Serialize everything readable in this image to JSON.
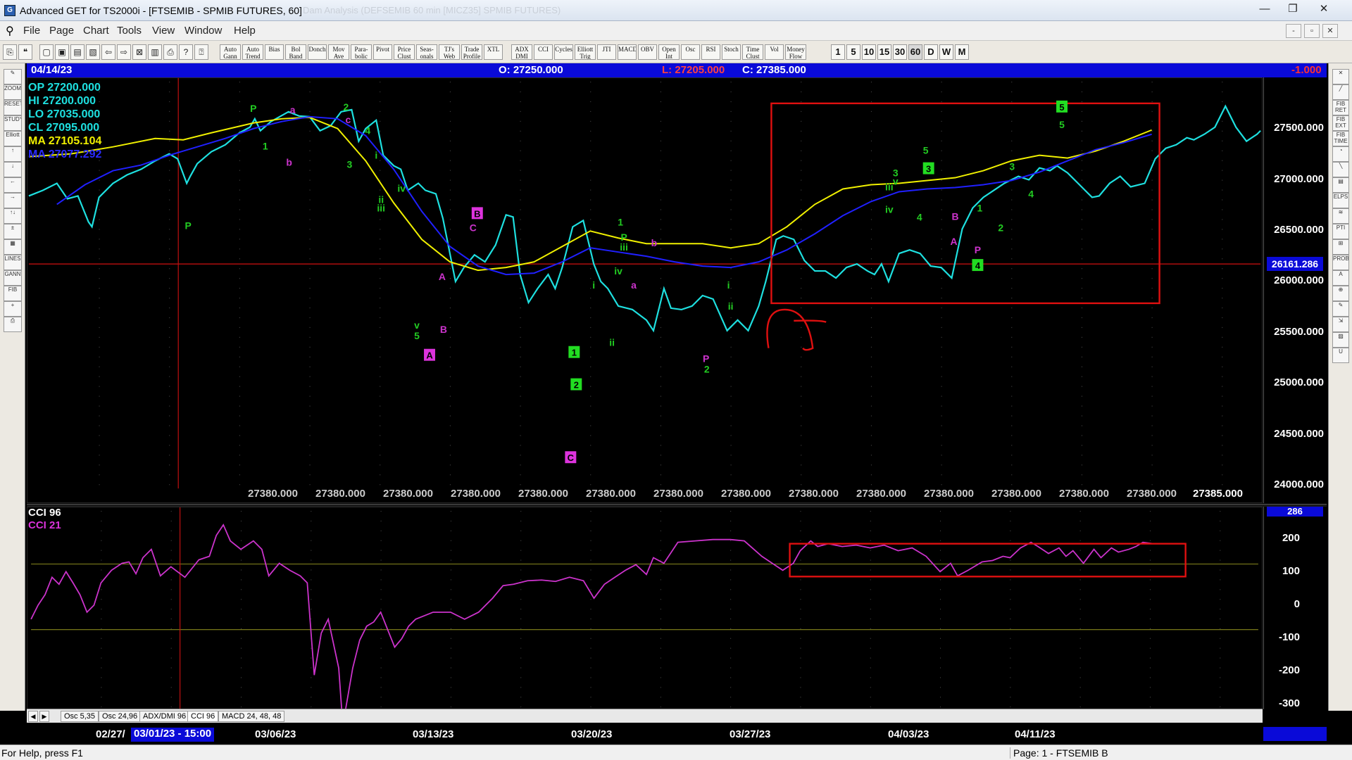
{
  "window": {
    "title": "Advanced GET for TS2000i - [FTSEMIB - SPMIB FUTURES, 60]",
    "ghost_title": "Dam Analysis (DEFSEMIB 60 min [MICZ35] SPMIB FUTURES)",
    "min_label": "—",
    "max_label": "❐",
    "close_label": "✕"
  },
  "menu": {
    "items": [
      "File",
      "Page",
      "Chart",
      "Tools",
      "View",
      "Window",
      "Help"
    ],
    "mdi_min": "-",
    "mdi_restore": "▫",
    "mdi_close": "✕"
  },
  "toolbar": {
    "icons_left": [
      "⎘",
      "❝",
      "▢",
      "▣",
      "▤",
      "▧",
      "⇦",
      "⇨",
      "⊠",
      "▥",
      "⎙",
      "?",
      "⍰"
    ],
    "tools": [
      "Auto Gann",
      "Auto Trend",
      "Bias",
      "Bol Band",
      "Donch",
      "Mov Ave",
      "Para- bolic",
      "Pivot",
      "Price Clust",
      "Seas- onals",
      "TJ's Web",
      "Trade Profile",
      "XTL",
      "ADX DMI",
      "CCI",
      "Cycles",
      "Elliott Trig",
      "JTI",
      "MACD",
      "OBV",
      "Open Int",
      "Osc",
      "RSI",
      "Stoch",
      "Time Clust",
      "Vol",
      "Money Flow"
    ],
    "timeframes": [
      "1",
      "5",
      "10",
      "15",
      "30",
      "60",
      "D",
      "W",
      "M"
    ],
    "active_timeframe": "60"
  },
  "left_tools": [
    "✎",
    "ZOOM",
    "RESET",
    "STUDY",
    "Elliott",
    "↑",
    "↓",
    "←",
    "→",
    "↑↓",
    "±",
    "▦",
    "LINES",
    "GANN",
    "FIB",
    "+",
    "⎙"
  ],
  "right_tools": [
    "✕",
    "╱",
    "FIB RET",
    "FIB EXT",
    "FIB TIME",
    "◔",
    "╲",
    "▤",
    "ELPS",
    "≋",
    "PTI",
    "⊞",
    "PROB",
    "A",
    "⊕",
    "✎",
    "⇲",
    "▨",
    "U"
  ],
  "header": {
    "date": "04/14/23",
    "open": "O: 27250.000",
    "low": "L: 27205.000",
    "close": "C: 27385.000",
    "change": "-1.000"
  },
  "ohlc_box": {
    "op": "OP 27200.000",
    "hi": "HI  27200.000",
    "lo": "LO  27035.000",
    "cl": "CL  27095.000",
    "ma1": "MA  27105.104",
    "ma2": "MA  27077.292"
  },
  "price_axis": {
    "ticks": [
      "27500.000",
      "27000.000",
      "26500.000",
      "26000.000",
      "25500.000",
      "25000.000",
      "24500.000",
      "24000.000"
    ],
    "current_marker": "26161.286"
  },
  "price_bottom": {
    "labels": [
      "27380.000",
      "27380.000",
      "27380.000",
      "27380.000",
      "27380.000",
      "27380.000",
      "27380.000",
      "27380.000",
      "27380.000",
      "27380.000",
      "27380.000",
      "27380.000",
      "27380.000",
      "27380.000"
    ],
    "last": "27385.000"
  },
  "elliott_labels": [
    {
      "t": "P",
      "c": "#22cc22"
    },
    {
      "t": "a",
      "c": "#cc33cc"
    },
    {
      "t": "1",
      "c": "#22cc22"
    },
    {
      "t": "b",
      "c": "#cc33cc"
    },
    {
      "t": "P",
      "c": "#22cc22"
    },
    {
      "t": "2",
      "c": "#22cc22"
    },
    {
      "t": "c",
      "c": "#cc33cc"
    },
    {
      "t": "3",
      "c": "#22cc22"
    },
    {
      "t": "4",
      "c": "#22cc22"
    },
    {
      "t": "i",
      "c": "#22cc22"
    },
    {
      "t": "iv",
      "c": "#22cc22"
    },
    {
      "t": "ii",
      "c": "#22cc22"
    },
    {
      "t": "iii",
      "c": "#22cc22"
    },
    {
      "t": "A",
      "c": "#cc33cc"
    },
    {
      "t": "v",
      "c": "#22cc22"
    },
    {
      "t": "5",
      "c": "#22cc22"
    },
    {
      "t": "B",
      "c": "#cc33cc"
    },
    {
      "t": "C",
      "c": "#cc33cc"
    },
    {
      "t": "1",
      "c": "#22cc22"
    },
    {
      "t": "iii",
      "c": "#22cc22"
    },
    {
      "t": "P",
      "c": "#22cc22"
    },
    {
      "t": "b",
      "c": "#cc33cc"
    },
    {
      "t": "iv",
      "c": "#22cc22"
    },
    {
      "t": "a",
      "c": "#cc33cc"
    },
    {
      "t": "i",
      "c": "#22cc22"
    },
    {
      "t": "ii",
      "c": "#22cc22"
    },
    {
      "t": "P",
      "c": "#cc33cc"
    },
    {
      "t": "2",
      "c": "#22cc22"
    },
    {
      "t": "i",
      "c": "#22cc22"
    },
    {
      "t": "ii",
      "c": "#22cc22"
    },
    {
      "t": "3",
      "c": "#22cc22"
    },
    {
      "t": "v",
      "c": "#22cc22"
    },
    {
      "t": "iii",
      "c": "#22cc22"
    },
    {
      "t": "iv",
      "c": "#22cc22"
    },
    {
      "t": "4",
      "c": "#22cc22"
    },
    {
      "t": "5",
      "c": "#22cc22"
    },
    {
      "t": "B",
      "c": "#cc33cc"
    },
    {
      "t": "A",
      "c": "#cc33cc"
    },
    {
      "t": "P",
      "c": "#cc33cc"
    },
    {
      "t": "1",
      "c": "#22cc22"
    },
    {
      "t": "2",
      "c": "#22cc22"
    },
    {
      "t": "3",
      "c": "#22cc22"
    },
    {
      "t": "4",
      "c": "#22cc22"
    },
    {
      "t": "5",
      "c": "#22cc22"
    }
  ],
  "boxed_labels": [
    {
      "t": "A",
      "c": "#dd33dd"
    },
    {
      "t": "B",
      "c": "#dd33dd"
    },
    {
      "t": "1",
      "c": "#22dd22"
    },
    {
      "t": "2",
      "c": "#22dd22"
    },
    {
      "t": "C",
      "c": "#dd33dd"
    },
    {
      "t": "3",
      "c": "#22dd22"
    },
    {
      "t": "4",
      "c": "#22dd22"
    },
    {
      "t": "5",
      "c": "#22dd22"
    }
  ],
  "cci": {
    "title1": "CCI 96",
    "title2": "CCI  21",
    "ticks": [
      "200",
      "100",
      "0",
      "-100",
      "-200",
      "-300"
    ],
    "marker": "286"
  },
  "tabs": {
    "nav_prev": "◀",
    "nav_next": "▶",
    "items": [
      "Osc 5,35",
      "Osc 24,96",
      "ADX/DMI 96",
      "CCI 96",
      "MACD 24, 48, 48"
    ],
    "active": "CCI 96"
  },
  "dates": {
    "labels": [
      "02/27/",
      "03/01/23 - 15:00",
      "03/06/23",
      "03/13/23",
      "03/20/23",
      "03/27/23",
      "04/03/23",
      "04/11/23"
    ]
  },
  "status": {
    "left": "For Help, press F1",
    "right": "Page: 1 - FTSEMIB B"
  },
  "colors": {
    "cyan": "#1ee0e0",
    "yellow_ma": "#f0f000",
    "blue_ma": "#2020ff",
    "magenta": "#cc33cc",
    "green": "#22cc22",
    "red": "#e01010",
    "header_blue": "#0a0ad8"
  }
}
